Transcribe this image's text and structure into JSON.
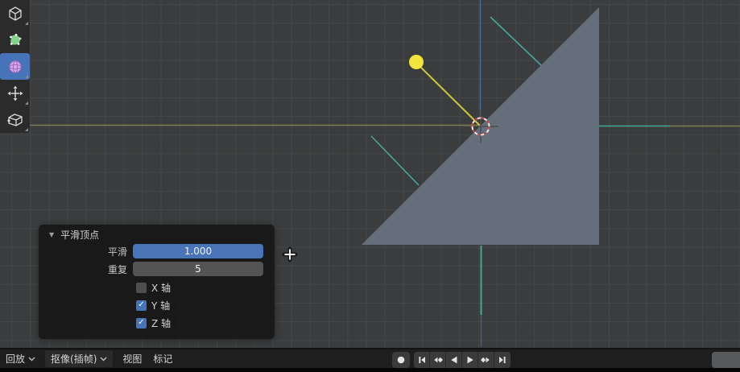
{
  "toolbar": {
    "tools": [
      {
        "name": "box-select",
        "active": false
      },
      {
        "name": "lasso-select",
        "active": false
      },
      {
        "name": "sphere",
        "active": true
      },
      {
        "name": "move",
        "active": false
      },
      {
        "name": "extrude",
        "active": false
      }
    ]
  },
  "operator_panel": {
    "title": "平滑顶点",
    "collapse_icon": "▼",
    "check_glyph": "✓",
    "fields": [
      {
        "label": "平滑",
        "value": "1.000"
      },
      {
        "label": "重复",
        "value": "5"
      }
    ],
    "axes": [
      {
        "label": "X 轴",
        "checked": false
      },
      {
        "label": "Y 轴",
        "checked": true
      },
      {
        "label": "Z 轴",
        "checked": true
      }
    ]
  },
  "statusbar": {
    "menus": [
      {
        "label": "回放",
        "dropdown": true
      },
      {
        "label": "抠像(插帧)",
        "dropdown": true
      },
      {
        "label": "视图",
        "dropdown": false
      },
      {
        "label": "标记",
        "dropdown": false
      }
    ],
    "playback_buttons": [
      "record",
      "jump-to-start",
      "previous-keyframe",
      "play-reverse",
      "play",
      "next-keyframe",
      "jump-to-end"
    ]
  },
  "colors": {
    "accent_blue": "#4773b8",
    "slider_blue": "#4a74b8",
    "field_gray": "#545454",
    "mesh_gray": "#656e7b",
    "vertex_yellow": "#f2e43a",
    "edge_yellow": "#cfc63c",
    "axis_olive": "#7b7e50",
    "axis_teal": "#45a79a",
    "axis_blue": "#4c6f9e",
    "axis_blue_dark": "#3e5c85",
    "cursor_red": "#c8414d",
    "cursor_white": "#e9e9e9"
  }
}
